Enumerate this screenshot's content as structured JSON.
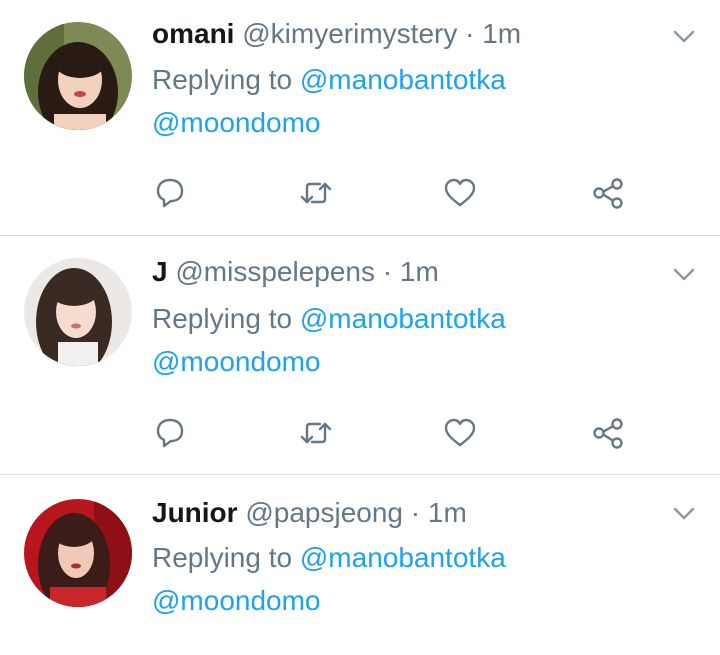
{
  "colors": {
    "name": "#14171a",
    "secondary": "#657786",
    "link": "#1da1f2",
    "divider": "#d9dfe4"
  },
  "tweets": [
    {
      "name": "omani",
      "handle": "@kimyerimystery",
      "separator": "·",
      "time": "1m",
      "replying_prefix": "Replying to",
      "mentions": [
        "@manobantotka",
        "@moondomo"
      ]
    },
    {
      "name": "J",
      "handle": "@misspelepens",
      "separator": "·",
      "time": "1m",
      "replying_prefix": "Replying to",
      "mentions": [
        "@manobantotka",
        "@moondomo"
      ]
    },
    {
      "name": "Junior",
      "handle": "@papsjeong",
      "separator": "·",
      "time": "1m",
      "replying_prefix": "Replying to",
      "mentions": [
        "@manobantotka",
        "@moondomo"
      ]
    }
  ],
  "icons": {
    "reply": "reply-icon",
    "retweet": "retweet-icon",
    "like": "heart-icon",
    "share": "share-icon",
    "menu": "chevron-down-icon"
  }
}
